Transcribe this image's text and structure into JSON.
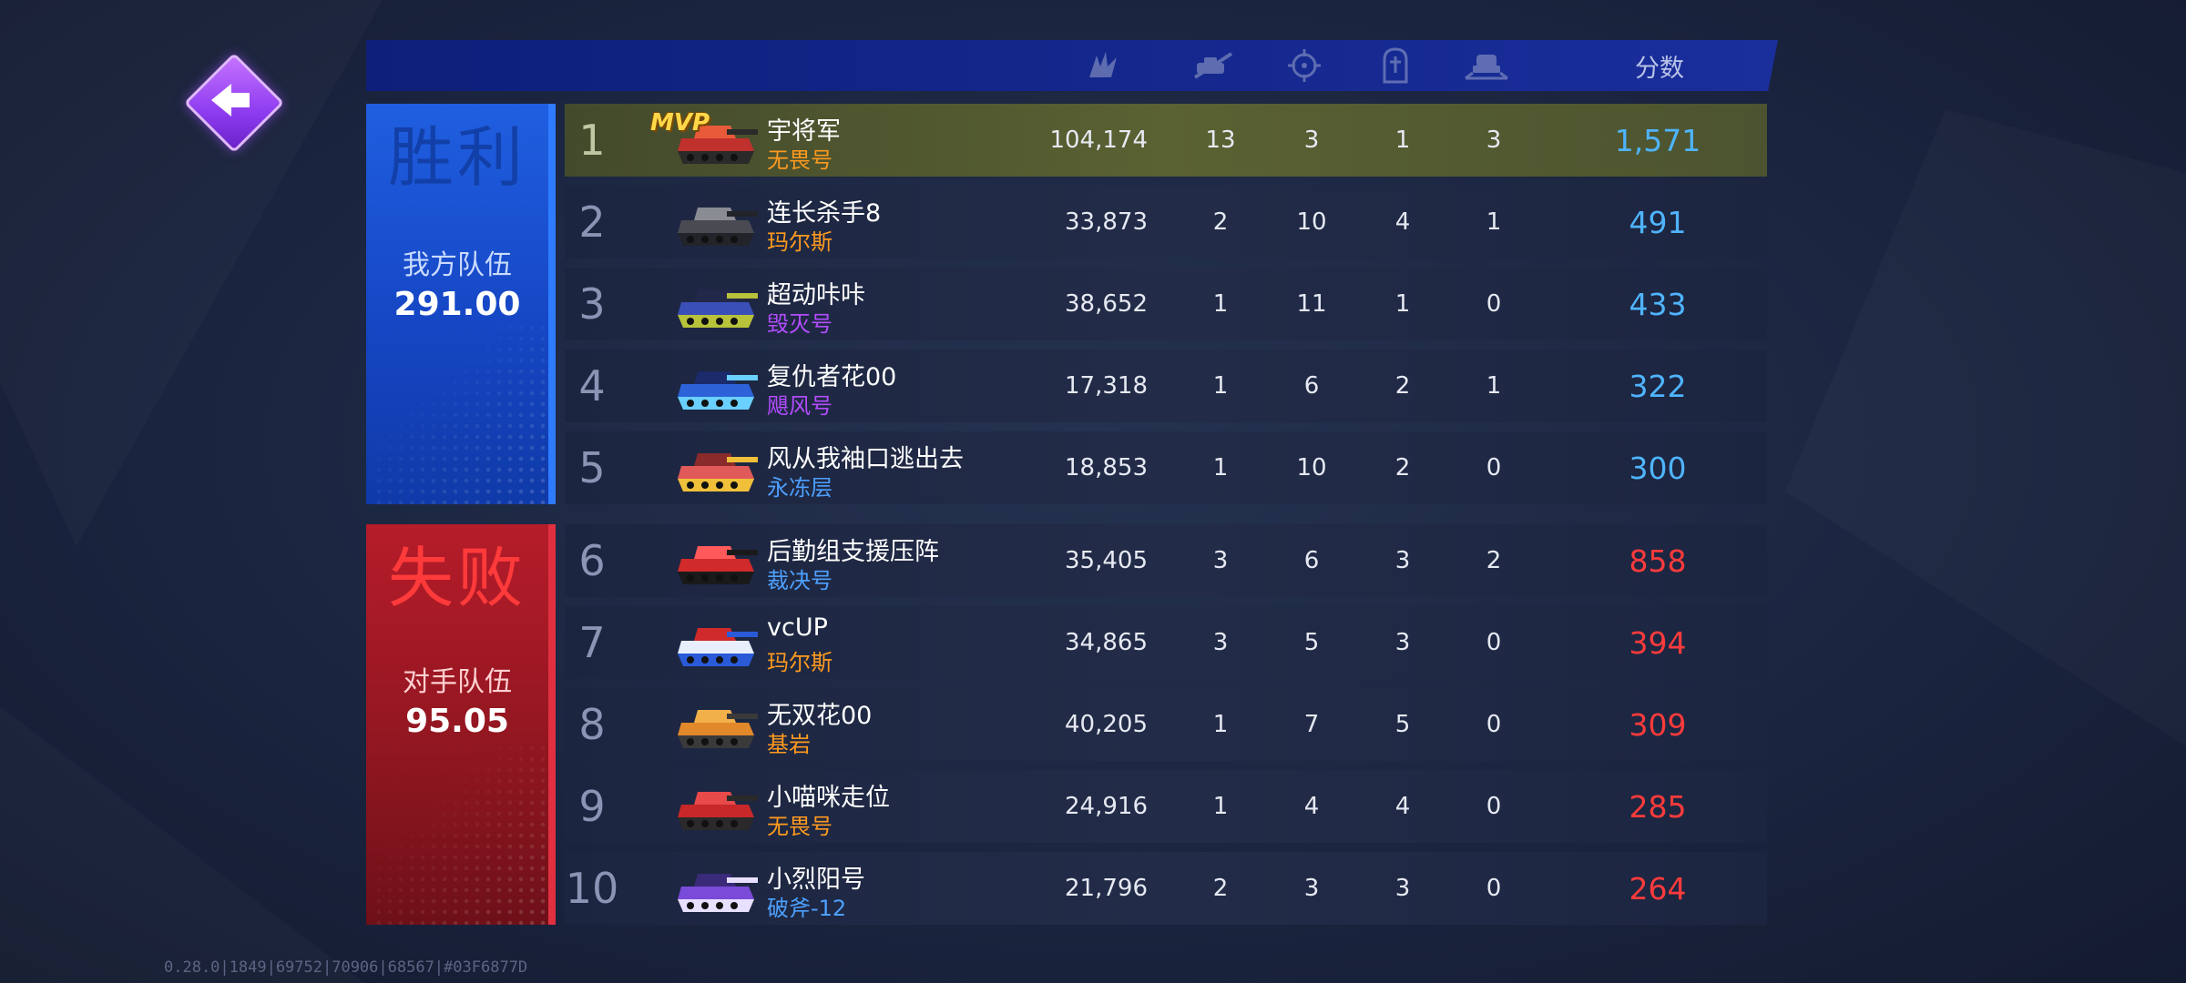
{
  "header": {
    "col_damage_icon": "damage-icon",
    "col_kills_icon": "kills-icon",
    "col_assists_icon": "assists-icon",
    "col_deaths_icon": "deaths-icon",
    "col_captures_icon": "captures-icon",
    "col_score_label": "分数"
  },
  "teams": {
    "win": {
      "result": "胜利",
      "label": "我方队伍",
      "score": "291.00",
      "color": "#1f5fe0",
      "score_color": "#4fb4ff"
    },
    "lose": {
      "result": "失败",
      "label": "对手队伍",
      "score": "95.05",
      "color": "#b61c2a",
      "score_color": "#ff3b3b"
    }
  },
  "mvp_label": "MVP",
  "rows": [
    {
      "rank": "1",
      "name": "宇将军",
      "tank": "无畏号",
      "tank_color": "#ff9a1e",
      "damage": "104,174",
      "kills": "13",
      "assists": "3",
      "deaths": "1",
      "captures": "3",
      "score": "1,571",
      "team": "win"
    },
    {
      "rank": "2",
      "name": "连长杀手8",
      "tank": "玛尔斯",
      "tank_color": "#ff9a1e",
      "damage": "33,873",
      "kills": "2",
      "assists": "10",
      "deaths": "4",
      "captures": "1",
      "score": "491",
      "team": "win"
    },
    {
      "rank": "3",
      "name": "超动咔咔",
      "tank": "毁灭号",
      "tank_color": "#b34cff",
      "damage": "38,652",
      "kills": "1",
      "assists": "11",
      "deaths": "1",
      "captures": "0",
      "score": "433",
      "team": "win"
    },
    {
      "rank": "4",
      "name": "复仇者花00",
      "tank": "飓风号",
      "tank_color": "#b34cff",
      "damage": "17,318",
      "kills": "1",
      "assists": "6",
      "deaths": "2",
      "captures": "1",
      "score": "322",
      "team": "win"
    },
    {
      "rank": "5",
      "name": "风从我袖口逃出去",
      "tank": "永冻层",
      "tank_color": "#4da0ff",
      "damage": "18,853",
      "kills": "1",
      "assists": "10",
      "deaths": "2",
      "captures": "0",
      "score": "300",
      "team": "win"
    },
    {
      "rank": "6",
      "name": "后勤组支援压阵",
      "tank": "裁决号",
      "tank_color": "#4da0ff",
      "damage": "35,405",
      "kills": "3",
      "assists": "6",
      "deaths": "3",
      "captures": "2",
      "score": "858",
      "team": "lose"
    },
    {
      "rank": "7",
      "name": "vcUP",
      "tank": "玛尔斯",
      "tank_color": "#ff9a1e",
      "damage": "34,865",
      "kills": "3",
      "assists": "5",
      "deaths": "3",
      "captures": "0",
      "score": "394",
      "team": "lose"
    },
    {
      "rank": "8",
      "name": "无双花00",
      "tank": "基岩",
      "tank_color": "#ff9a1e",
      "damage": "40,205",
      "kills": "1",
      "assists": "7",
      "deaths": "5",
      "captures": "0",
      "score": "309",
      "team": "lose"
    },
    {
      "rank": "9",
      "name": "小喵咪走位",
      "tank": "无畏号",
      "tank_color": "#ff9a1e",
      "damage": "24,916",
      "kills": "1",
      "assists": "4",
      "deaths": "4",
      "captures": "0",
      "score": "285",
      "team": "lose"
    },
    {
      "rank": "10",
      "name": "小烈阳号",
      "tank": "破斧-12",
      "tank_color": "#4da0ff",
      "damage": "21,796",
      "kills": "2",
      "assists": "3",
      "deaths": "3",
      "captures": "0",
      "score": "264",
      "team": "lose"
    }
  ],
  "version": "0.28.0|1849|69752|70906|68567|#03F6877D"
}
